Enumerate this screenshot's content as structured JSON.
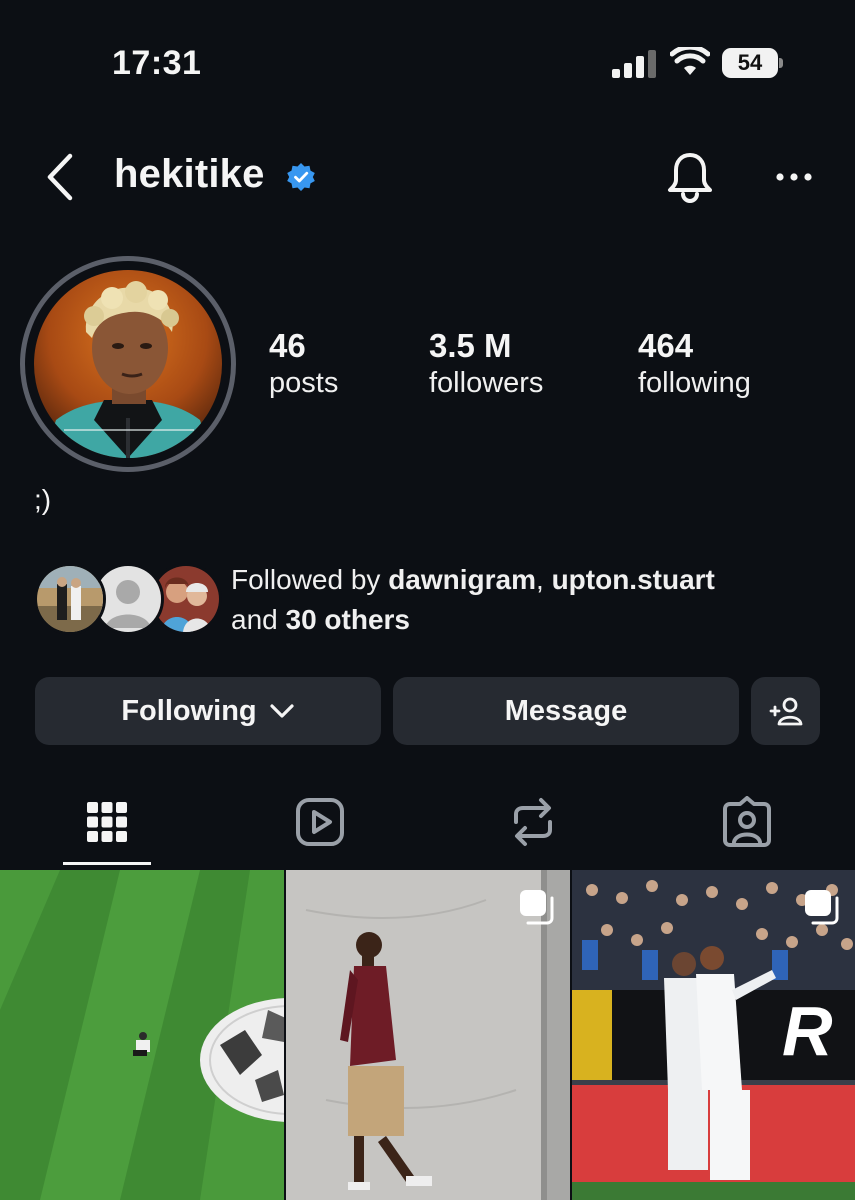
{
  "status_bar": {
    "time": "17:31",
    "battery": "54",
    "icons": [
      "signal-icon",
      "wifi-icon",
      "battery-icon"
    ]
  },
  "header": {
    "username": "hekitike",
    "verified": true,
    "icons": [
      "back-chevron-icon",
      "verified-badge-icon",
      "bell-icon",
      "more-icon"
    ]
  },
  "profile": {
    "stats": [
      {
        "value": "46",
        "label": "posts"
      },
      {
        "value": "3.5 M",
        "label": "followers"
      },
      {
        "value": "464",
        "label": "following"
      }
    ],
    "bio": ";)",
    "followed_by": {
      "prefix": "Followed by ",
      "user1": "dawnigram",
      "separator": ", ",
      "user2": "upton.stuart",
      "and": "and ",
      "others": "30 others"
    }
  },
  "actions": {
    "following_label": "Following",
    "message_label": "Message"
  },
  "tabs": [
    {
      "icon": "grid-icon",
      "active": true
    },
    {
      "icon": "reels-icon",
      "active": false
    },
    {
      "icon": "reposts-icon",
      "active": false
    },
    {
      "icon": "tagged-icon",
      "active": false
    }
  ],
  "colors": {
    "background": "#0c0f14",
    "button": "#262a31",
    "verified": "#3897f0"
  }
}
